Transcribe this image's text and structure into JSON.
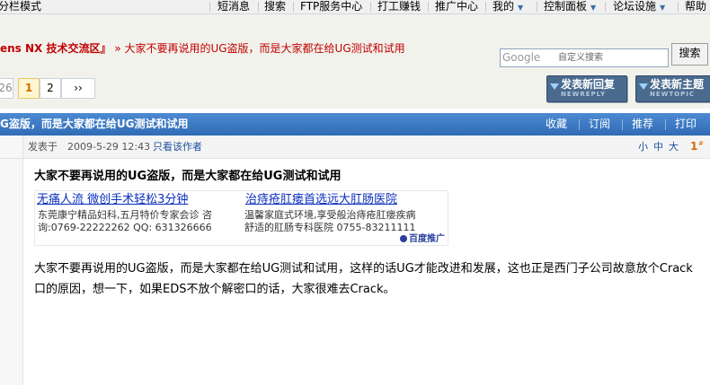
{
  "topbar": {
    "mode_label": "分栏模式",
    "nav": [
      {
        "label": "短消息"
      },
      {
        "label": "搜索"
      },
      {
        "label": "FTP服务中心"
      },
      {
        "label": "打工赚钱"
      },
      {
        "label": "推广中心"
      },
      {
        "label": "我的"
      },
      {
        "label": "控制面板"
      },
      {
        "label": "论坛设施"
      },
      {
        "label": "帮助"
      }
    ]
  },
  "header": {
    "forum_name": "ens NX 技术交流区』",
    "thread_crumb": "» 大家不要再说用的UG盗版，而是大家都在给UG测试和试用",
    "search_logo": "Google",
    "search_placeholder": "自定义搜索",
    "search_button": "搜索"
  },
  "pager": {
    "prev": "26",
    "pages": [
      "1",
      "2"
    ],
    "current": "1",
    "next": "››"
  },
  "actions": {
    "reply": {
      "label": "发表新回复",
      "sub": "NEWREPLY"
    },
    "new_topic": {
      "label": "发表新主题",
      "sub": "NEWTOPIC"
    }
  },
  "titlebar": {
    "title": "G盗版，而是大家都在给UG测试和试用",
    "links": [
      "收藏",
      "订阅",
      "推荐",
      "打印"
    ]
  },
  "post": {
    "posted_label": "发表于",
    "posted_time": "2009-5-29 12:43",
    "only_author": "只看该作者",
    "font_sizes": [
      "小",
      "中",
      "大"
    ],
    "floor": "1",
    "floor_sup": "#",
    "title": "大家不要再说用的UG盗版，而是大家都在给UG测试和试用",
    "ads": [
      {
        "title": "无痛人流 微创手术轻松3分钟",
        "desc1": "东莞康宁精品妇科,五月特价专家会诊 咨",
        "desc2": "询:0769-22222262 QQ: 631326666"
      },
      {
        "title": "治痔疮肛瘘首选远大肛肠医院",
        "desc1": "温馨家庭式环境,享受般治痔疮肛瘘疾病",
        "desc2": "舒适的肛肠专科医院  0755-83211111"
      }
    ],
    "ad_brand": "百度推广",
    "body": "大家不要再说用的UG盗版，而是大家都在给UG测试和试用，这样的话UG才能改进和发展，这也正是西门子公司故意放个Crack口的原因，想一下，如果EDS不放个解密口的话，大家很难去Crack。"
  },
  "colors": {
    "title_bar": "#3a78c2",
    "forum_red": "#c00000",
    "link_blue": "#1c4fa0",
    "current_page": "#d46900"
  }
}
